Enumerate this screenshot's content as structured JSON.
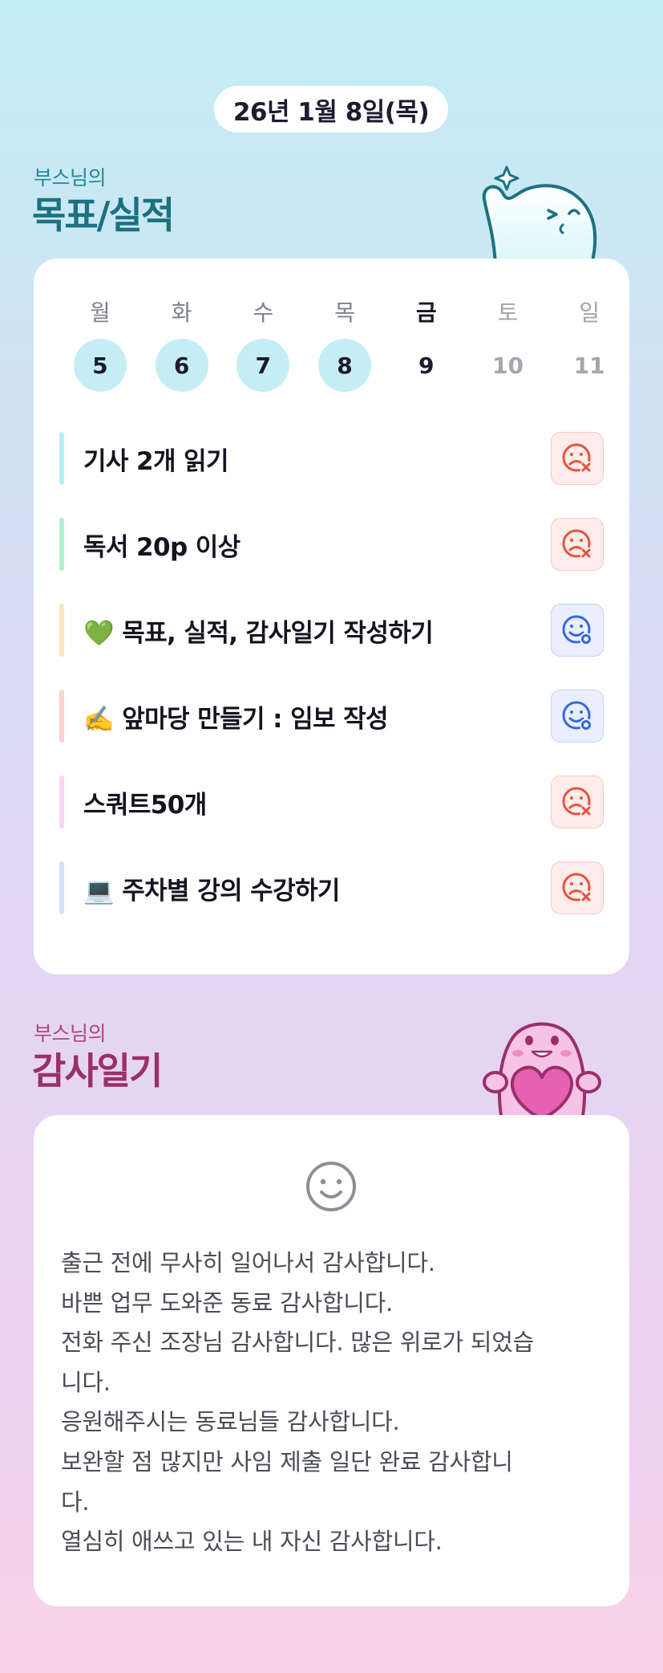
{
  "header": {
    "date": "26년 1월 8일(목)"
  },
  "goals": {
    "subtitle": "부스님의",
    "title": "목표/실적",
    "week": [
      {
        "name": "월",
        "num": "5",
        "state": "done"
      },
      {
        "name": "화",
        "num": "6",
        "state": "done"
      },
      {
        "name": "수",
        "num": "7",
        "state": "done"
      },
      {
        "name": "목",
        "num": "8",
        "state": "done"
      },
      {
        "name": "금",
        "num": "9",
        "state": "current"
      },
      {
        "name": "토",
        "num": "10",
        "state": "weekend"
      },
      {
        "name": "일",
        "num": "11",
        "state": "weekend"
      }
    ],
    "tasks": [
      {
        "label": "기사 2개 읽기",
        "bar_color": "#b5eff4",
        "status": "fail",
        "status_icon": "sad-face-x-icon"
      },
      {
        "label": "독서 20p 이상",
        "bar_color": "#b3f0d0",
        "status": "fail",
        "status_icon": "sad-face-x-icon"
      },
      {
        "label": "💚 목표, 실적, 감사일기 작성하기",
        "bar_color": "#fde6bd",
        "status": "success",
        "status_icon": "happy-face-o-icon"
      },
      {
        "label": "✍️ 앞마당 만들기 : 임보 작성",
        "bar_color": "#fdd3cf",
        "status": "success",
        "status_icon": "happy-face-o-icon"
      },
      {
        "label": "스쿼트50개",
        "bar_color": "#fbd3f1",
        "status": "fail",
        "status_icon": "sad-face-x-icon"
      },
      {
        "label": "💻 주차별 강의 수강하기",
        "bar_color": "#d6e1fb",
        "status": "fail",
        "status_icon": "sad-face-x-icon"
      }
    ]
  },
  "gratitude": {
    "subtitle": "부스님의",
    "title": "감사일기",
    "mood_icon": "smile-face-icon",
    "lines": [
      "출근 전에 무사히 일어나서 감사합니다.",
      "바쁜 업무 도와준 동료 감사합니다.",
      "전화 주신 조장님 감사합니다. 많은 위로가 되었습",
      "니다.",
      "응원해주시는 동료님들 감사합니다.",
      "보완할 점 많지만 사임 제출 일단 완료 감사합니",
      "다.",
      "열심히 애쓰고 있는 내 자신 감사합니다."
    ]
  },
  "colors": {
    "accent_teal": "#1c7180",
    "accent_pink": "#9a2f6c",
    "done_circle": "#c5eef4",
    "fail": "#e5533f",
    "success": "#3868dc"
  }
}
